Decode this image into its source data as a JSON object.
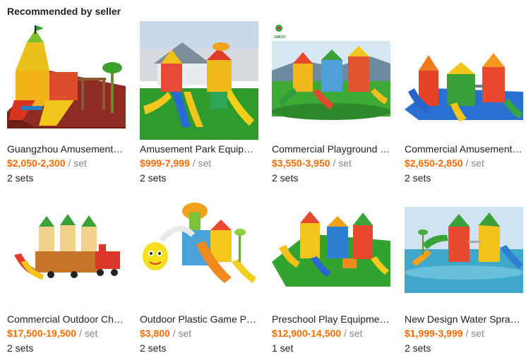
{
  "section": {
    "title": "Recommended by seller"
  },
  "products": [
    {
      "name": "Guangzhou Amusement E...",
      "price": "$2,050-2,300",
      "unit": " / set",
      "moq": "2 sets",
      "image": "playground-rubber-floor"
    },
    {
      "name": "Amusement Park Equipm...",
      "price": "$999-7,999",
      "unit": " / set",
      "moq": "2 sets",
      "image": "playground-grass-house"
    },
    {
      "name": "Commercial Playground E...",
      "price": "$3,550-3,950",
      "unit": " / set",
      "moq": "2 sets",
      "image": "playground-green-field",
      "logo_text": "GMICH"
    },
    {
      "name": "Commercial Amusement ...",
      "price": "$2,650-2,850",
      "unit": " / set",
      "moq": "2 sets",
      "image": "playground-blue-floor"
    },
    {
      "name": "Commercial Outdoor Chil...",
      "price": "$17,500-19,500",
      "unit": " / set",
      "moq": "2 sets",
      "image": "castle-train-playground"
    },
    {
      "name": "Outdoor Plastic Game Pla...",
      "price": "$3,800",
      "unit": " / set",
      "moq": "2 sets",
      "image": "bee-playground"
    },
    {
      "name": "Preschool Play Equipmen...",
      "price": "$12,900-14,500",
      "unit": " / set",
      "moq": "1 set",
      "image": "preschool-playground"
    },
    {
      "name": "New Design Water Spray ...",
      "price": "$1,999-3,999",
      "unit": " / set",
      "moq": "2 sets",
      "image": "water-park-playground"
    }
  ]
}
